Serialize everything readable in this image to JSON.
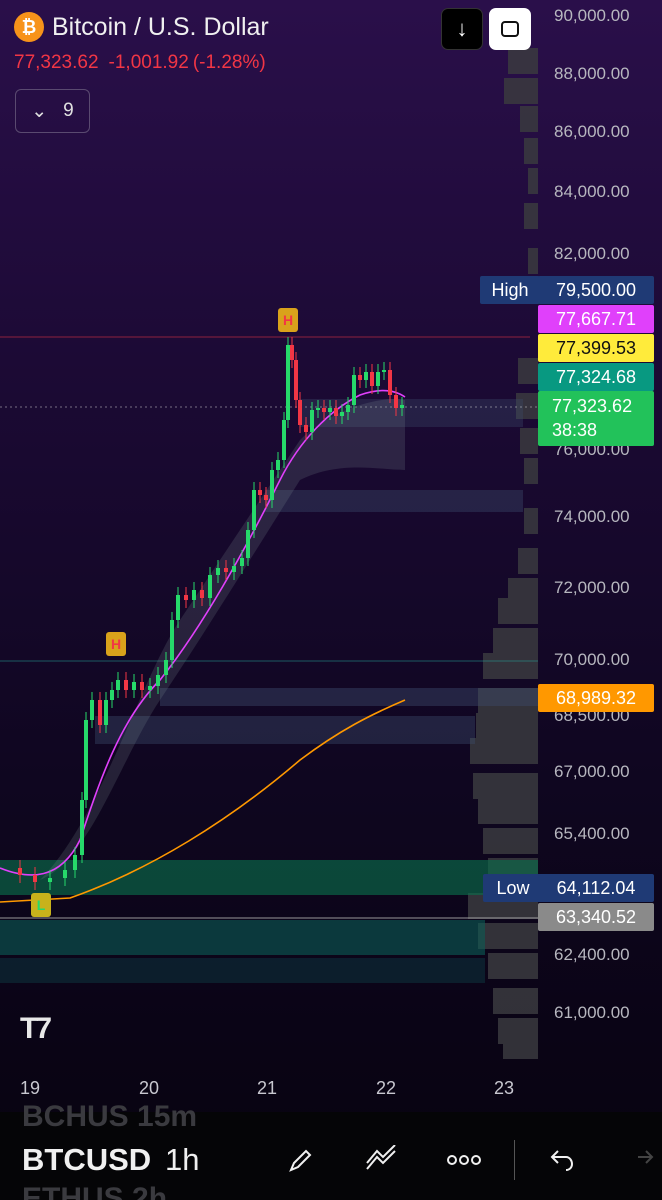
{
  "symbol": {
    "title": "Bitcoin / U.S. Dollar",
    "icon": "bitcoin-icon",
    "last": "77,323.62",
    "change": "-1,001.92",
    "change_pct": "(-1.28%)"
  },
  "indicator_toggle": {
    "count": "9"
  },
  "price_axis": [
    "90,000.00",
    "88,000.00",
    "86,000.00",
    "84,000.00",
    "82,000.00",
    "76,000.00",
    "74,000.00",
    "72,000.00",
    "70,000.00",
    "68,500.00",
    "67,000.00",
    "65,400.00",
    "62,400.00",
    "61,000.00"
  ],
  "tags": {
    "high_label": "High",
    "high_value": "79,500.00",
    "magenta": "77,667.71",
    "yellow": "77,399.53",
    "teal": "77,324.68",
    "current_price": "77,323.62",
    "countdown": "38:38",
    "orange": "68,989.32",
    "low_label": "Low",
    "low_value": "64,112.04",
    "gray": "63,340.52"
  },
  "colors": {
    "up": "#26d96a",
    "down": "#f23645",
    "magenta": "#e040fb",
    "yellow": "#ffeb3b",
    "teal": "#089981",
    "orange": "#ff9800",
    "current": "#22c25a",
    "high_low": "#1f3a75",
    "gray": "#8a8a8a"
  },
  "markers": [
    "H",
    "H",
    "L"
  ],
  "dates": [
    "19",
    "20",
    "21",
    "22",
    "23"
  ],
  "bottom": {
    "ghost_top": "BCHUS  15m",
    "symbol": "BTCUSD",
    "interval": "1h",
    "ghost_bottom": "ETHUS  2h",
    "tools": [
      "pen-icon",
      "trend-icon",
      "more-icon",
      "undo-icon",
      "redo-icon"
    ]
  }
}
